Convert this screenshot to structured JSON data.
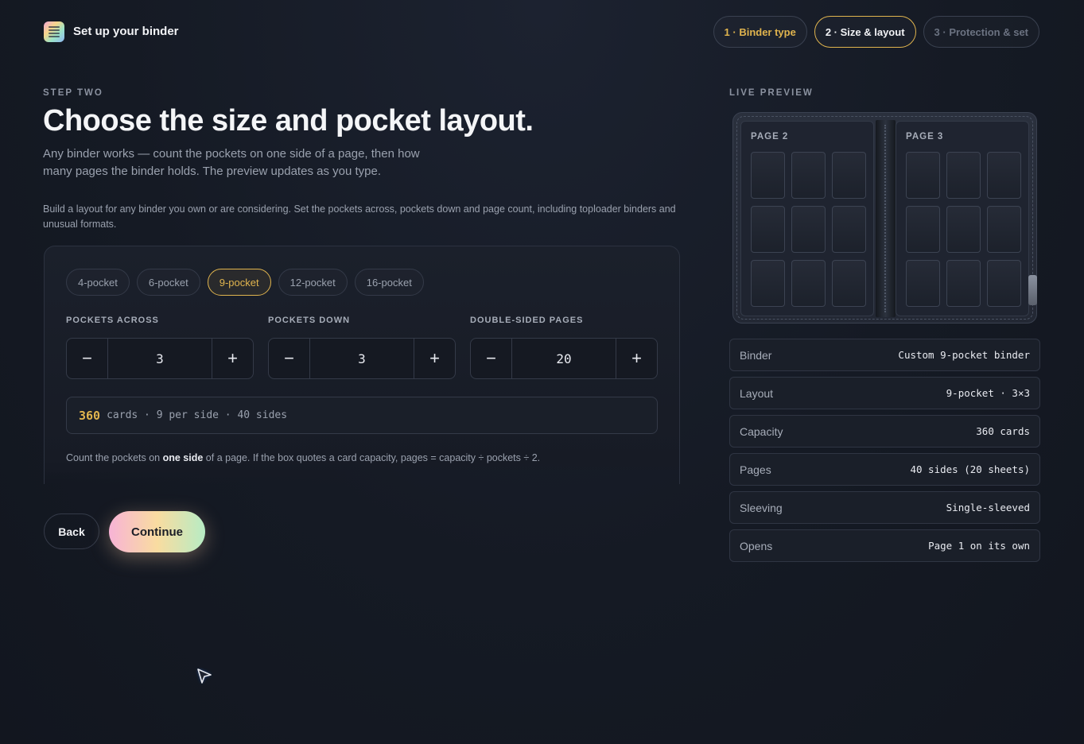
{
  "header": {
    "brand": "Set up your binder",
    "steps": [
      {
        "label": "1 · Binder type",
        "state": "done"
      },
      {
        "label": "2 · Size & layout",
        "state": "active"
      },
      {
        "label": "3 · Protection & set",
        "state": "upcoming"
      }
    ]
  },
  "main": {
    "eyebrow": "STEP TWO",
    "title": "Choose the size and pocket layout.",
    "lead": "Any binder works — count the pockets on one side of a page, then how many pages the binder holds. The preview updates as you type.",
    "description": "Build a layout for any binder you own or are considering. Set the pockets across, pockets down and page count, including toploader binders and unusual formats.",
    "presets": [
      "4-pocket",
      "6-pocket",
      "9-pocket",
      "12-pocket",
      "16-pocket"
    ],
    "selected_preset": "9-pocket",
    "fields": {
      "across": {
        "label": "POCKETS ACROSS",
        "value": "3"
      },
      "down": {
        "label": "POCKETS DOWN",
        "value": "3"
      },
      "pages": {
        "label": "DOUBLE-SIDED PAGES",
        "value": "20"
      }
    },
    "stepper_minus": "−",
    "stepper_plus": "+",
    "summary": {
      "count": "360",
      "rest": "cards · 9 per side · 40 sides"
    },
    "hint": {
      "before": "Count the pockets on ",
      "bold": "one side",
      "after": " of a page. If the box quotes a card capacity, pages = capacity ÷ pockets ÷ 2."
    },
    "back_label": "Back",
    "continue_label": "Continue"
  },
  "preview": {
    "eyebrow": "LIVE PREVIEW",
    "left_page": "PAGE 2",
    "right_page": "PAGE 3",
    "grid": {
      "cols": 3,
      "rows": 3
    },
    "specs": [
      {
        "key": "Binder",
        "value": "Custom 9-pocket binder"
      },
      {
        "key": "Layout",
        "value": "9-pocket · 3×3"
      },
      {
        "key": "Capacity",
        "value": "360 cards"
      },
      {
        "key": "Pages",
        "value": "40 sides (20 sheets)"
      },
      {
        "key": "Sleeving",
        "value": "Single-sleeved"
      },
      {
        "key": "Opens",
        "value": "Page 1 on its own"
      }
    ]
  },
  "colors": {
    "accent": "#e0b44e",
    "background": "#151a24"
  }
}
